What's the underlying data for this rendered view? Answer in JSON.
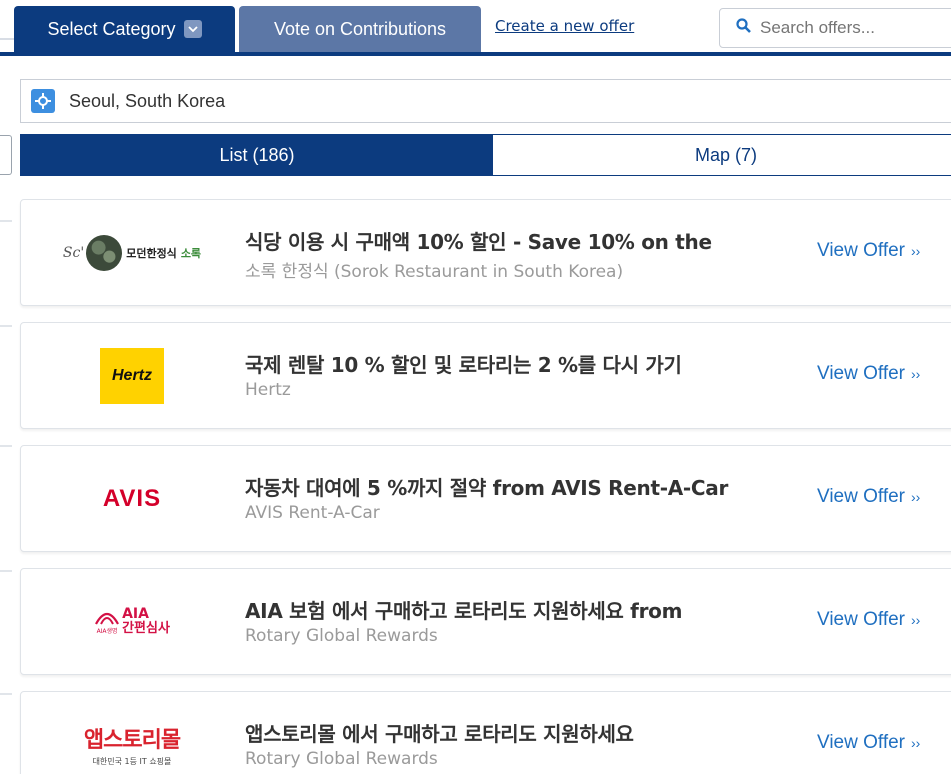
{
  "header": {
    "select_category_label": "Select Category",
    "vote_label": "Vote on Contributions",
    "create_offer_link": "Create a new offer",
    "search_placeholder": "Search offers...",
    "brand_color": "#0c3b7f",
    "secondary_tab_color": "#5c77a6"
  },
  "location": {
    "value": "Seoul, South Korea",
    "icon": "locate-crosshair-icon"
  },
  "view_toggle": {
    "list_label": "List (186)",
    "map_label": "Map (7)",
    "active": "list"
  },
  "offers": [
    {
      "logo_text_a": "Sc'",
      "logo_text_b": "모던한정식",
      "logo_text_c": "소록",
      "title": "식당 이용 시 구매액 10% 할인 - Save 10% on the",
      "subtitle": "소록 한정식 (Sorok Restaurant in South Korea)",
      "action": "View Offer"
    },
    {
      "logo_text_a": "Hertz",
      "title": "국제 렌탈 10 % 할인 및 로타리는 2 %를 다시 가기",
      "subtitle": "Hertz",
      "action": "View Offer"
    },
    {
      "logo_text_a": "AVIS",
      "title": "자동차 대여에 5 %까지 절약 from AVIS Rent-A-Car",
      "subtitle": "AVIS Rent-A-Car",
      "action": "View Offer"
    },
    {
      "logo_text_a": "AIA",
      "logo_text_b": "간편심사",
      "logo_text_c": "AIA생명",
      "title": "AIA 보험 에서 구매하고 로타리도 지원하세요 from",
      "subtitle": "Rotary Global Rewards",
      "action": "View Offer"
    },
    {
      "logo_text_a": "앱스토리몰",
      "logo_text_b": "대한민국 1등 IT 쇼핑몰",
      "title": "앱스토리몰 에서 구매하고 로타리도 지원하세요",
      "subtitle": "Rotary Global Rewards",
      "action": "View Offer"
    }
  ]
}
